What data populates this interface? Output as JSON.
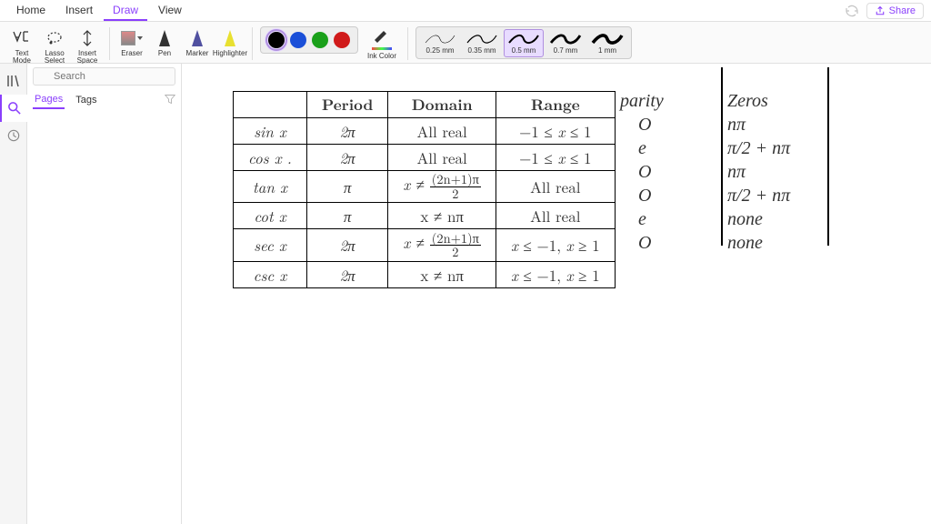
{
  "menu": {
    "items": [
      "Home",
      "Insert",
      "Draw",
      "View"
    ],
    "active_index": 2,
    "share_label": "Share"
  },
  "toolbar": {
    "text_mode": "Text\nMode",
    "lasso": "Lasso\nSelect",
    "insert_space": "Insert\nSpace",
    "eraser": "Eraser",
    "pen": "Pen",
    "marker": "Marker",
    "highlighter": "Highlighter",
    "ink_color": "Ink\nColor",
    "colors": [
      {
        "name": "black",
        "hex": "#000000",
        "selected": true
      },
      {
        "name": "blue",
        "hex": "#1a4fd8",
        "selected": false
      },
      {
        "name": "green",
        "hex": "#1aa01a",
        "selected": false
      },
      {
        "name": "red",
        "hex": "#d01a1a",
        "selected": false
      }
    ],
    "strokes": [
      {
        "label": "0.25 mm",
        "w": 0.6,
        "selected": false
      },
      {
        "label": "0.35 mm",
        "w": 1.2,
        "selected": false
      },
      {
        "label": "0.5 mm",
        "w": 2.0,
        "selected": true
      },
      {
        "label": "0.7 mm",
        "w": 2.8,
        "selected": false
      },
      {
        "label": "1 mm",
        "w": 3.6,
        "selected": false
      }
    ]
  },
  "sidebar": {
    "search_placeholder": "Search",
    "tabs": [
      "Pages",
      "Tags"
    ],
    "active_tab": 0
  },
  "table": {
    "headers": [
      "",
      "Period",
      "Domain",
      "Range"
    ],
    "rows": [
      {
        "fn": "sin x",
        "period": "2π",
        "domain": "All real",
        "range": "−1 ≤ x ≤ 1"
      },
      {
        "fn": "cos x .",
        "period": "2π",
        "domain": "All real",
        "range": "−1 ≤ x ≤ 1"
      },
      {
        "fn": "tan x",
        "period": "π",
        "domain_frac": {
          "pre": "x ≠ ",
          "num": "(2n+1)π",
          "den": "2"
        },
        "range": "All real"
      },
      {
        "fn": "cot x",
        "period": "π",
        "domain": "x ≠ nπ",
        "range": "All real"
      },
      {
        "fn": "sec x",
        "period": "2π",
        "domain_frac": {
          "pre": "x ≠ ",
          "num": "(2n+1)π",
          "den": "2"
        },
        "range": "x ≤ −1, x ≥ 1"
      },
      {
        "fn": "csc x",
        "period": "2π",
        "domain": "x ≠ nπ",
        "range": "x ≤ −1, x ≥ 1"
      }
    ]
  },
  "handwriting": {
    "parity_header": "parity",
    "zeros_header": "Zeros",
    "parity": [
      "O",
      "e",
      "O",
      "O",
      "e",
      "O"
    ],
    "zeros": [
      "nπ",
      "π/2 + nπ",
      "nπ",
      "π/2 + nπ",
      "none",
      "none"
    ]
  }
}
